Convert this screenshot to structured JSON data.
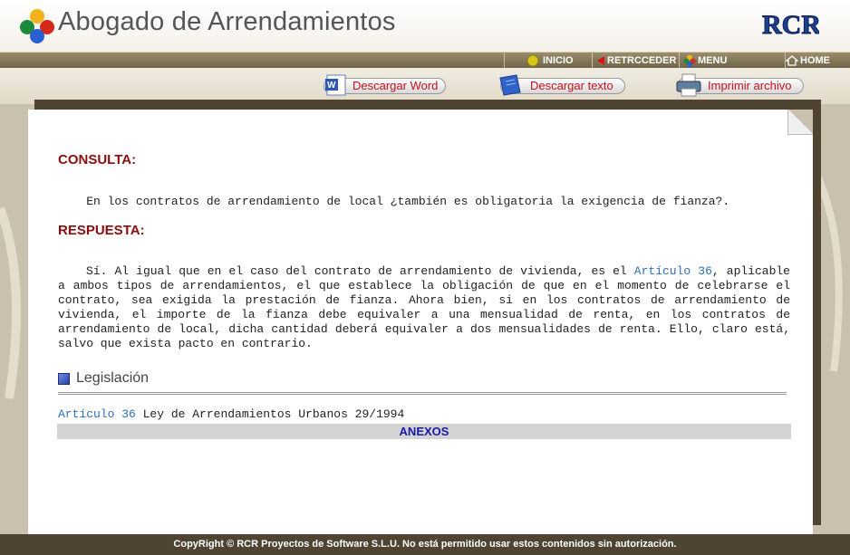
{
  "header": {
    "app_title": "Abogado de Arrendamientos",
    "brand": "RCR"
  },
  "nav": {
    "items": [
      {
        "label": "INICIO",
        "icon": "circle-icon"
      },
      {
        "label": "RETRCCEDER",
        "icon": "back-arrow-icon"
      },
      {
        "label": "MENU",
        "icon": "menu-logo-icon"
      },
      {
        "label": "HOME",
        "icon": "home-icon"
      }
    ]
  },
  "toolbar": {
    "word_label": "Descargar Word",
    "text_label": "Descargar texto",
    "print_label": "Imprimir archivo"
  },
  "content": {
    "consulta_heading": "CONSULTA:",
    "question": "    En los contratos de arrendamiento de local ¿también es obligatoria la exigencia de fianza?.",
    "respuesta_heading": "RESPUESTA:",
    "answer_before_link": "Sí. Al igual que en el caso del contrato de arrendamiento de vivienda, es el ",
    "answer_link": "Artículo 36",
    "answer_after_link": ", aplicable a ambos tipos de arrendamientos, el que establece la obligación de que en el momento de celebrarse el contrato, sea exigida la prestación de fianza. Ahora bien, si en los contratos de arrendamiento de vivienda, el importe de la fianza debe equivaler a una mensualidad de renta, en los contratos de arrendamiento de local, dicha cantidad deberá equivaler a dos mensualidades de renta. Ello, claro está, salvo que exista pacto en contrario."
  },
  "legislacion": {
    "heading": "Legislación",
    "link": "Artículo 36",
    "text": " Ley de Arrendamientos Urbanos 29/1994",
    "anexos": "ANEXOS"
  },
  "footer": {
    "text": "CopyRight © RCR Proyectos de Software S.L.U. No está permitido usar estos contenidos sin autorización."
  },
  "colors": {
    "heading_red": "#8b0d0d",
    "link_blue": "#2f6fb4",
    "frame_brown": "#4f4431",
    "button_red": "#c8101e"
  }
}
